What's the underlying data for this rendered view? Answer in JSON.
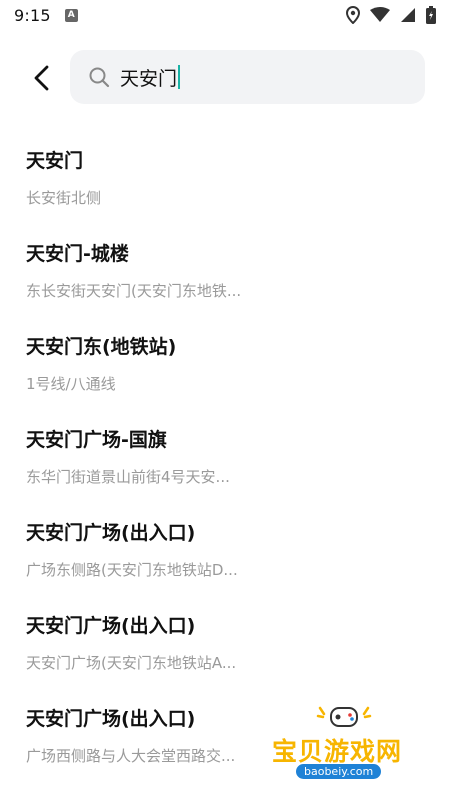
{
  "status_bar": {
    "time": "9:15",
    "notification_icon": "A"
  },
  "header": {
    "back_icon": "chevron-left-icon",
    "search": {
      "query": "天安门",
      "icon": "search-icon"
    }
  },
  "results": [
    {
      "title": "天安门",
      "subtitle": "长安街北侧"
    },
    {
      "title": "天安门-城楼",
      "subtitle": "东长安街天安门(天安门东地铁..."
    },
    {
      "title": "天安门东(地铁站)",
      "subtitle": "1号线/八通线"
    },
    {
      "title": "天安门广场-国旗",
      "subtitle": "东华门街道景山前街4号天安..."
    },
    {
      "title": "天安门广场(出入口)",
      "subtitle": "广场东侧路(天安门东地铁站D..."
    },
    {
      "title": "天安门广场(出入口)",
      "subtitle": "天安门广场(天安门东地铁站A..."
    },
    {
      "title": "天安门广场(出入口)",
      "subtitle": "广场西侧路与人大会堂西路交..."
    }
  ],
  "watermark": {
    "text": "宝贝游戏网",
    "url": "baobeiy.com"
  },
  "colors": {
    "cursor": "#19b3a6",
    "search_bg": "#f2f3f5",
    "subtitle": "#9a9a9a",
    "watermark": "#f7b500",
    "watermark_url_bg": "#1f82d6"
  }
}
